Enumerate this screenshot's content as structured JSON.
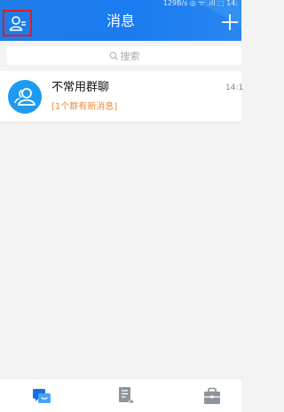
{
  "status_bar": {
    "text": "129B/s ◎ ᯤ .ıll ⬚ 14:"
  },
  "header": {
    "title": "消息",
    "contacts_icon": "contacts-icon",
    "add_icon": "plus-icon",
    "accent_color": "#1a7cf0",
    "highlight_color": "#e31b23"
  },
  "search": {
    "placeholder": "搜索",
    "icon": "search-icon"
  },
  "conversations": [
    {
      "name": "不常用群聊",
      "time": "14:1",
      "preview": "[1个群有新消息]",
      "preview_color": "#f08a30",
      "avatar_icon": "group-avatar-icon",
      "avatar_color": "#1e9bf0"
    }
  ],
  "tabbar": {
    "items": [
      {
        "icon": "chat-bubbles-icon",
        "active": true
      },
      {
        "icon": "document-icon",
        "active": false
      },
      {
        "icon": "briefcase-icon",
        "active": false
      }
    ]
  }
}
